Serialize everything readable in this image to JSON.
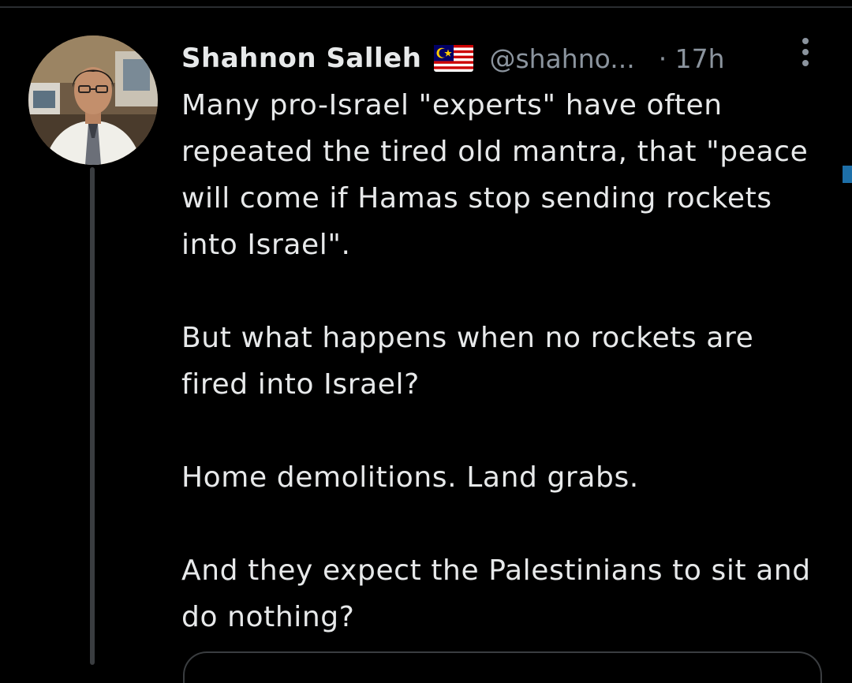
{
  "tweet": {
    "author": {
      "display_name": "Shahnon Salleh",
      "flag_icon": "malaysia-flag-icon",
      "handle": "@shahno...",
      "avatar_icon": "profile-photo"
    },
    "timestamp": "· 17h",
    "more_icon": "vertical-ellipsis-icon",
    "paragraphs": [
      "Many pro-Israel \"experts\" have often repeated the tired old mantra, that \"peace will come if Hamas stop sending rockets into Israel\".",
      "But what happens when no rockets are fired into Israel?",
      "Home demolitions. Land grabs.",
      "And they expect the Palestinians to sit and do nothing?"
    ]
  },
  "colors": {
    "background": "#000000",
    "text_primary": "#e7e9ea",
    "text_secondary": "#8b949e",
    "thread_line": "#3a3d40",
    "accent": "#1d6fa8"
  }
}
